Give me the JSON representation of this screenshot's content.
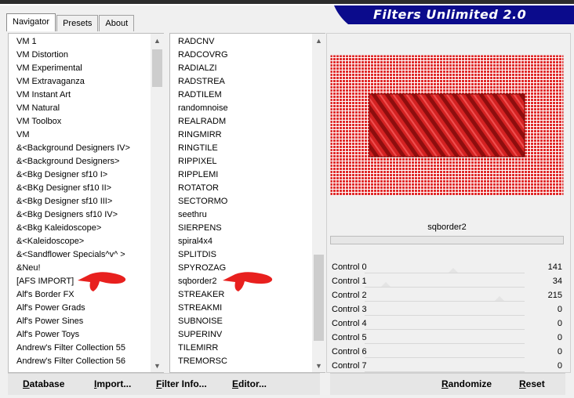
{
  "tabs": [
    "Navigator",
    "Presets",
    "About"
  ],
  "brand": {
    "title": "Filters Unlimited 2.0",
    "color": "#0b0b8c"
  },
  "categories": [
    "VM 1",
    "VM Distortion",
    "VM Experimental",
    "VM Extravaganza",
    "VM Instant Art",
    "VM Natural",
    "VM Toolbox",
    "VM",
    "&<Background Designers IV>",
    "&<Background Designers>",
    "&<Bkg Designer sf10 I>",
    "&<BKg Designer sf10 II>",
    "&<Bkg Designer sf10 III>",
    "&<Bkg Designers sf10 IV>",
    "&<Bkg Kaleidoscope>",
    "&<Kaleidoscope>",
    "&<Sandflower Specials^v^ >",
    "&Neu!",
    "[AFS IMPORT]",
    "Alf's Border FX",
    "Alf's Power Grads",
    "Alf's Power Sines",
    "Alf's Power Toys",
    "Andrew's Filter Collection 55",
    "Andrew's Filter Collection 56"
  ],
  "filters": [
    "RADCNV",
    "RADCOVRG",
    "RADIALZI",
    "RADSTREA",
    "RADTILEM",
    "randomnoise",
    "REALRADM",
    "RINGMIRR",
    "RINGTILE",
    "RIPPIXEL",
    "RIPPLEMI",
    "ROTATOR",
    "SECTORMO",
    "seethru",
    "SIERPENS",
    "spiral4x4",
    "SPLITDIS",
    "SPYROZAG",
    "sqborder2",
    "STREAKER",
    "STREAKMI",
    "SUBNOISE",
    "SUPERINV",
    "TILEMIRR",
    "TREMORSC"
  ],
  "selected_filter": "sqborder2",
  "controls": [
    {
      "label": "Control 0",
      "value": "141",
      "level": 141
    },
    {
      "label": "Control 1",
      "value": "34",
      "level": 34
    },
    {
      "label": "Control 2",
      "value": "215",
      "level": 215
    },
    {
      "label": "Control 3",
      "value": "0",
      "level": 0
    },
    {
      "label": "Control 4",
      "value": "0",
      "level": 0
    },
    {
      "label": "Control 5",
      "value": "0",
      "level": 0
    },
    {
      "label": "Control 6",
      "value": "0",
      "level": 0
    },
    {
      "label": "Control 7",
      "value": "0",
      "level": 0
    }
  ],
  "bottom_left_buttons": [
    {
      "u": "D",
      "rest": "atabase"
    },
    {
      "u": "I",
      "rest": "mport..."
    },
    {
      "u": "F",
      "rest": "ilter Info..."
    },
    {
      "u": "E",
      "rest": "ditor..."
    }
  ],
  "bottom_right_buttons": [
    {
      "u": "R",
      "rest": "andomize"
    },
    {
      "u": "R",
      "rest": "eset"
    }
  ],
  "colors": {
    "preview_red": "#e02b2b",
    "preview_dark": "#8e0e0e",
    "arrow_red": "#e8201e"
  }
}
